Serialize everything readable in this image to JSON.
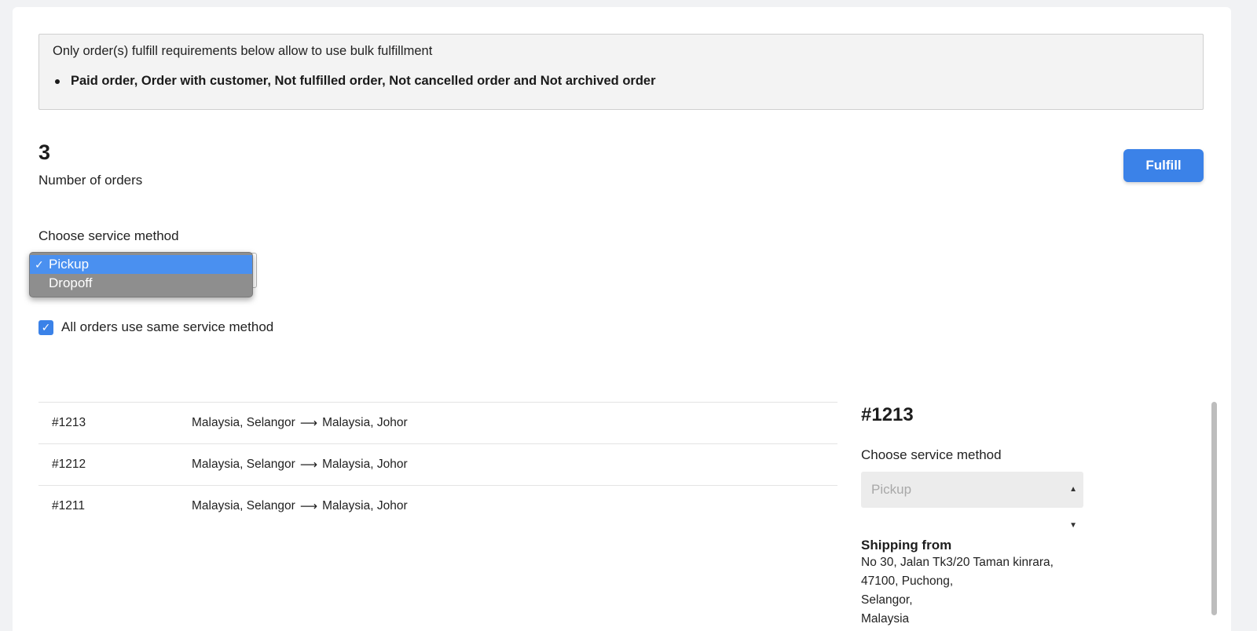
{
  "notice": {
    "text": "Only order(s) fulfill requirements below allow to use bulk fulfillment",
    "requirements": "Paid order, Order with customer, Not fulfilled order, Not cancelled order and Not archived order"
  },
  "summary": {
    "order_count": "3",
    "order_count_label": "Number of orders"
  },
  "actions": {
    "fulfill_label": "Fulfill"
  },
  "service_method": {
    "label": "Choose service method",
    "options": [
      "Pickup",
      "Dropoff"
    ],
    "selected": "Pickup",
    "check_glyph": "✓"
  },
  "same_method": {
    "checked": true,
    "label": "All orders use same service method"
  },
  "orders": [
    {
      "id": "#1213",
      "from": "Malaysia, Selangor",
      "to": "Malaysia, Johor"
    },
    {
      "id": "#1212",
      "from": "Malaysia, Selangor",
      "to": "Malaysia, Johor"
    },
    {
      "id": "#1211",
      "from": "Malaysia, Selangor",
      "to": "Malaysia, Johor"
    }
  ],
  "route_arrow": "⟶",
  "detail": {
    "title": "#1213",
    "method_label": "Choose service method",
    "method_value": "Pickup",
    "shipping_title": "Shipping from",
    "address_lines": [
      "No 30, Jalan Tk3/20 Taman kinrara,",
      "47100, Puchong,",
      "Selangor,",
      "Malaysia"
    ]
  },
  "colors": {
    "accent": "#3b82e8",
    "dropdown_selected": "#4a90f0",
    "dropdown_bg": "#8e8e8e"
  }
}
